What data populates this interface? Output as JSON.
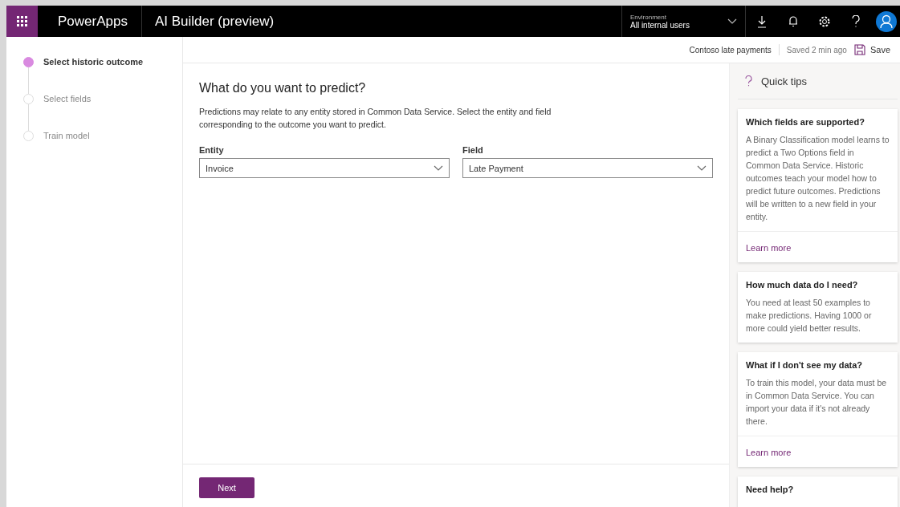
{
  "header": {
    "app_name": "PowerApps",
    "title": "AI Builder (preview)",
    "environment_label": "Environment",
    "environment_value": "All internal users"
  },
  "steps": [
    {
      "label": "Select historic outcome",
      "selected": true
    },
    {
      "label": "Select fields",
      "selected": false
    },
    {
      "label": "Train model",
      "selected": false
    }
  ],
  "toolbar": {
    "model_name": "Contoso late payments",
    "saved": "Saved 2 min ago",
    "save": "Save"
  },
  "main": {
    "heading": "What do you want to predict?",
    "description": "Predictions may relate to any entity stored in Common Data Service. Select the entity and field corresponding to the outcome you want to predict.",
    "fields": [
      {
        "label": "Entity",
        "value": "Invoice"
      },
      {
        "label": "Field",
        "value": "Late Payment"
      }
    ],
    "next": "Next"
  },
  "tips": {
    "title": "Quick tips",
    "cards": [
      {
        "title": "Which fields are supported?",
        "body": "A Binary Classification model learns to predict a Two Options field in Common Data Service. Historic outcomes teach your model how to predict future outcomes. Predictions will be written to a new field in your entity.",
        "link": "Learn more"
      },
      {
        "title": "How much data do I need?",
        "body": "You need at least 50 examples to make predictions. Having 1000 or more could yield better results."
      },
      {
        "title": "What if I don't see my data?",
        "body": "To train this model, your data must be in Common Data Service. You can import your data if it's not already there.",
        "link": "Learn more"
      },
      {
        "title": "Need help?"
      }
    ]
  }
}
